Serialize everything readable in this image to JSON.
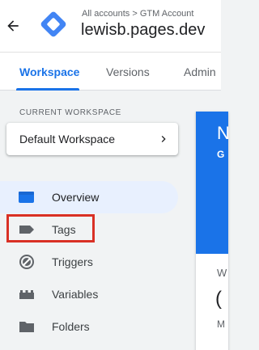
{
  "header": {
    "breadcrumb": "All accounts > GTM Account",
    "container_name": "lewisb.pages.dev",
    "back_icon": "arrow-back-icon",
    "logo_icon": "gtm-logo-icon"
  },
  "tabs": [
    {
      "label": "Workspace",
      "active": true
    },
    {
      "label": "Versions",
      "active": false
    },
    {
      "label": "Admin",
      "active": false
    }
  ],
  "workspace": {
    "section_label": "CURRENT WORKSPACE",
    "name": "Default Workspace",
    "chevron_icon": "chevron-right-icon"
  },
  "nav": [
    {
      "label": "Overview",
      "icon": "overview-icon",
      "active": true
    },
    {
      "label": "Tags",
      "icon": "tag-icon",
      "active": false,
      "highlighted": true
    },
    {
      "label": "Triggers",
      "icon": "trigger-icon",
      "active": false
    },
    {
      "label": "Variables",
      "icon": "variables-icon",
      "active": false
    },
    {
      "label": "Folders",
      "icon": "folder-icon",
      "active": false
    }
  ],
  "panel": {
    "hero_initial": "N",
    "hero_sub": "G",
    "section_initial": "W",
    "value_initial": "(",
    "caption_initial": "M"
  },
  "colors": {
    "accent": "#1a73e8",
    "active_nav_bg": "#e8f0fe",
    "highlight": "#d93025",
    "background": "#f1f3f4"
  }
}
